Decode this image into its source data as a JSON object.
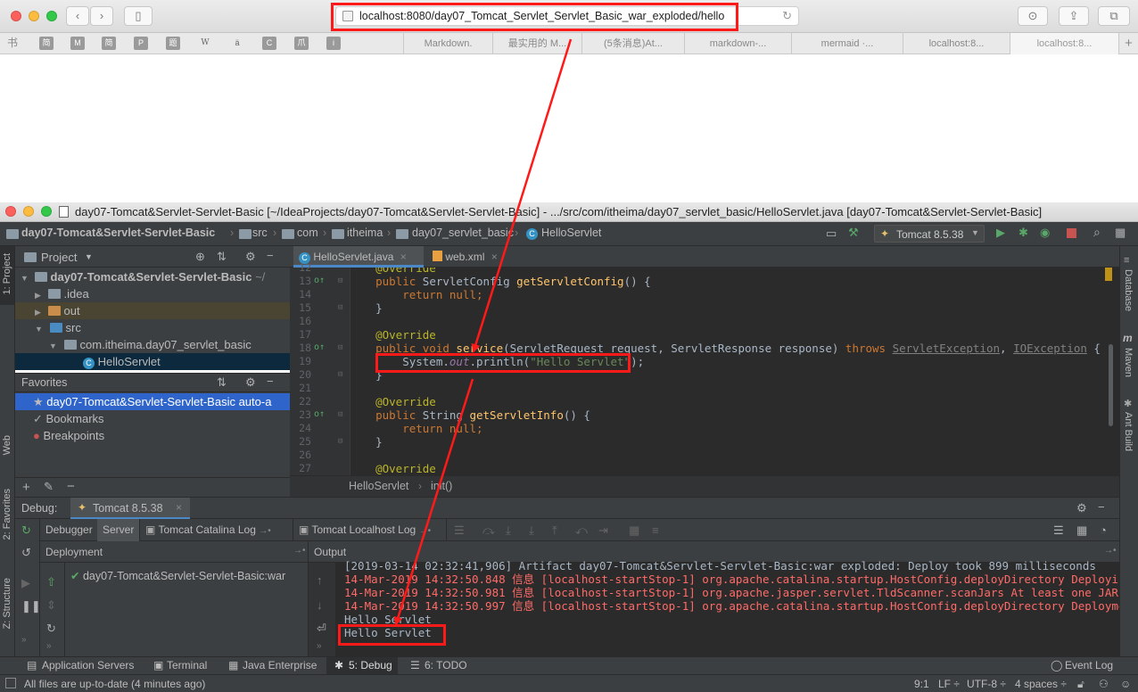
{
  "safari": {
    "url": "localhost:8080/day07_Tomcat_Servlet_Servlet_Basic_war_exploded/hello",
    "bookmark_icons": [
      "书",
      "简",
      "M",
      "简",
      "P",
      "题",
      "W",
      "ä",
      "C",
      "爪",
      "i"
    ],
    "tabs": [
      "Markdown.",
      "最实用的 M...",
      "(5条消息)At...",
      "markdown-...",
      "mermaid ·...",
      "localhost:8...",
      "localhost:8..."
    ]
  },
  "idea": {
    "title": "day07-Tomcat&Servlet-Servlet-Basic [~/IdeaProjects/day07-Tomcat&Servlet-Servlet-Basic] - .../src/com/itheima/day07_servlet_basic/HelloServlet.java [day07-Tomcat&Servlet-Servlet-Basic]",
    "breadcrumbs": [
      "day07-Tomcat&Servlet-Servlet-Basic",
      "src",
      "com",
      "itheima",
      "day07_servlet_basic",
      "HelloServlet"
    ],
    "run_config": "Tomcat 8.5.38",
    "left_tabs": [
      "1: Project",
      "Web",
      "2: Favorites",
      "Z: Structure"
    ],
    "right_tabs": [
      "Database",
      "Maven",
      "Ant Build"
    ],
    "project": {
      "header": "Project",
      "root": "day07-Tomcat&Servlet-Servlet-Basic",
      "root_suffix": "~/",
      "items": [
        ".idea",
        "out",
        "src",
        "com.itheima.day07_servlet_basic",
        "HelloServlet"
      ]
    },
    "favorites": {
      "header": "Favorites",
      "items": [
        "day07-Tomcat&Servlet-Servlet-Basic  auto-a",
        "Bookmarks",
        "Breakpoints"
      ]
    },
    "editor": {
      "tabs": [
        "HelloServlet.java",
        "web.xml"
      ],
      "line_numbers": [
        "12",
        "13",
        "14",
        "15",
        "16",
        "17",
        "18",
        "19",
        "20",
        "21",
        "22",
        "23",
        "24",
        "25",
        "26",
        "27"
      ],
      "crumb": [
        "HelloServlet",
        "init()"
      ]
    },
    "debug": {
      "label": "Debug:",
      "session": "Tomcat 8.5.38",
      "tabs": [
        "Debugger",
        "Server",
        "Tomcat Catalina Log",
        "Tomcat Localhost Log"
      ],
      "deployment_header": "Deployment",
      "deployment_item": "day07-Tomcat&Servlet-Servlet-Basic:war",
      "output_header": "Output",
      "output_lines": [
        "[2019-03-14 02:32:41,906] Artifact day07-Tomcat&Servlet-Servlet-Basic:war exploded: Deploy took 899 milliseconds",
        "14-Mar-2019 14:32:50.848 信息 [localhost-startStop-1] org.apache.catalina.startup.HostConfig.deployDirectory Deploying web ap",
        "14-Mar-2019 14:32:50.981 信息 [localhost-startStop-1] org.apache.jasper.servlet.TldScanner.scanJars At least one JAR was scar",
        "14-Mar-2019 14:32:50.997 信息 [localhost-startStop-1] org.apache.catalina.startup.HostConfig.deployDirectory Deployment of we",
        "Hello Servlet",
        "Hello Servlet"
      ]
    },
    "bottom_tools": [
      "Application Servers",
      "Terminal",
      "Java Enterprise",
      "5: Debug",
      "6: TODO",
      "Event Log"
    ],
    "status": {
      "message": "All files are up-to-date (4 minutes ago)",
      "position": "9:1",
      "line_sep": "LF ÷",
      "encoding": "UTF-8 ÷",
      "indent": "4 spaces ÷"
    }
  },
  "code": {
    "l12": "    @Override",
    "l13_a": "    public ",
    "l13_b": "ServletConfig ",
    "l13_c": "getServletConfig",
    "l13_d": "() {",
    "l14_a": "        return null",
    "l14_b": ";",
    "l15": "    }",
    "l17": "    @Override",
    "l18_a": "    public void ",
    "l18_b": "service",
    "l18_c": "(ServletRequest request, ServletResponse response) ",
    "l18_d": "throws ",
    "l18_e": "ServletException",
    "l18_f": ", ",
    "l18_g": "IOException",
    "l18_h": " {",
    "l19_a": "        System.",
    "l19_b": "out",
    "l19_c": ".println(",
    "l19_d": "\"Hello Servlet\"",
    "l19_e": ");",
    "l20": "    }",
    "l22": "    @Override",
    "l23_a": "    public ",
    "l23_b": "String ",
    "l23_c": "getServletInfo",
    "l23_d": "() {",
    "l24_a": "        return null",
    "l24_b": ";",
    "l25": "    }",
    "l27": "    @Override"
  },
  "colors": {
    "annotation_red": "#ff1a1a",
    "ide_bg": "#3c3f41",
    "editor_bg": "#2b2b2b",
    "selection": "#2f65ca"
  }
}
